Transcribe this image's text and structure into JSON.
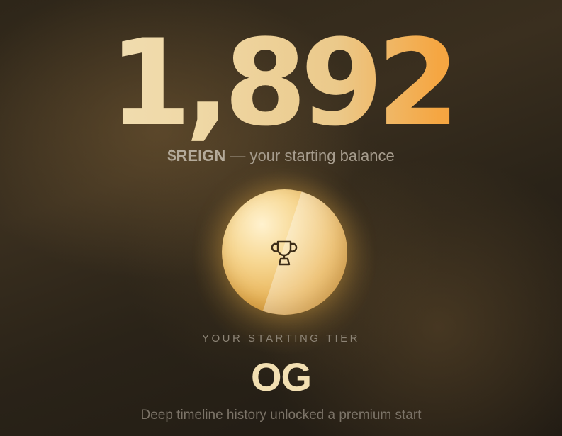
{
  "balance": {
    "amount": "1,892",
    "token": "$REIGN",
    "caption": " — your starting balance"
  },
  "tier": {
    "icon": "trophy-icon",
    "label": "YOUR STARTING TIER",
    "name": "OG",
    "description": "Deep timeline history unlocked a premium start"
  },
  "colors": {
    "gold_light": "#f3e2bb",
    "gold_orange": "#f59a34",
    "orb_gold": "#e9b55a",
    "background": "#2a2318"
  }
}
